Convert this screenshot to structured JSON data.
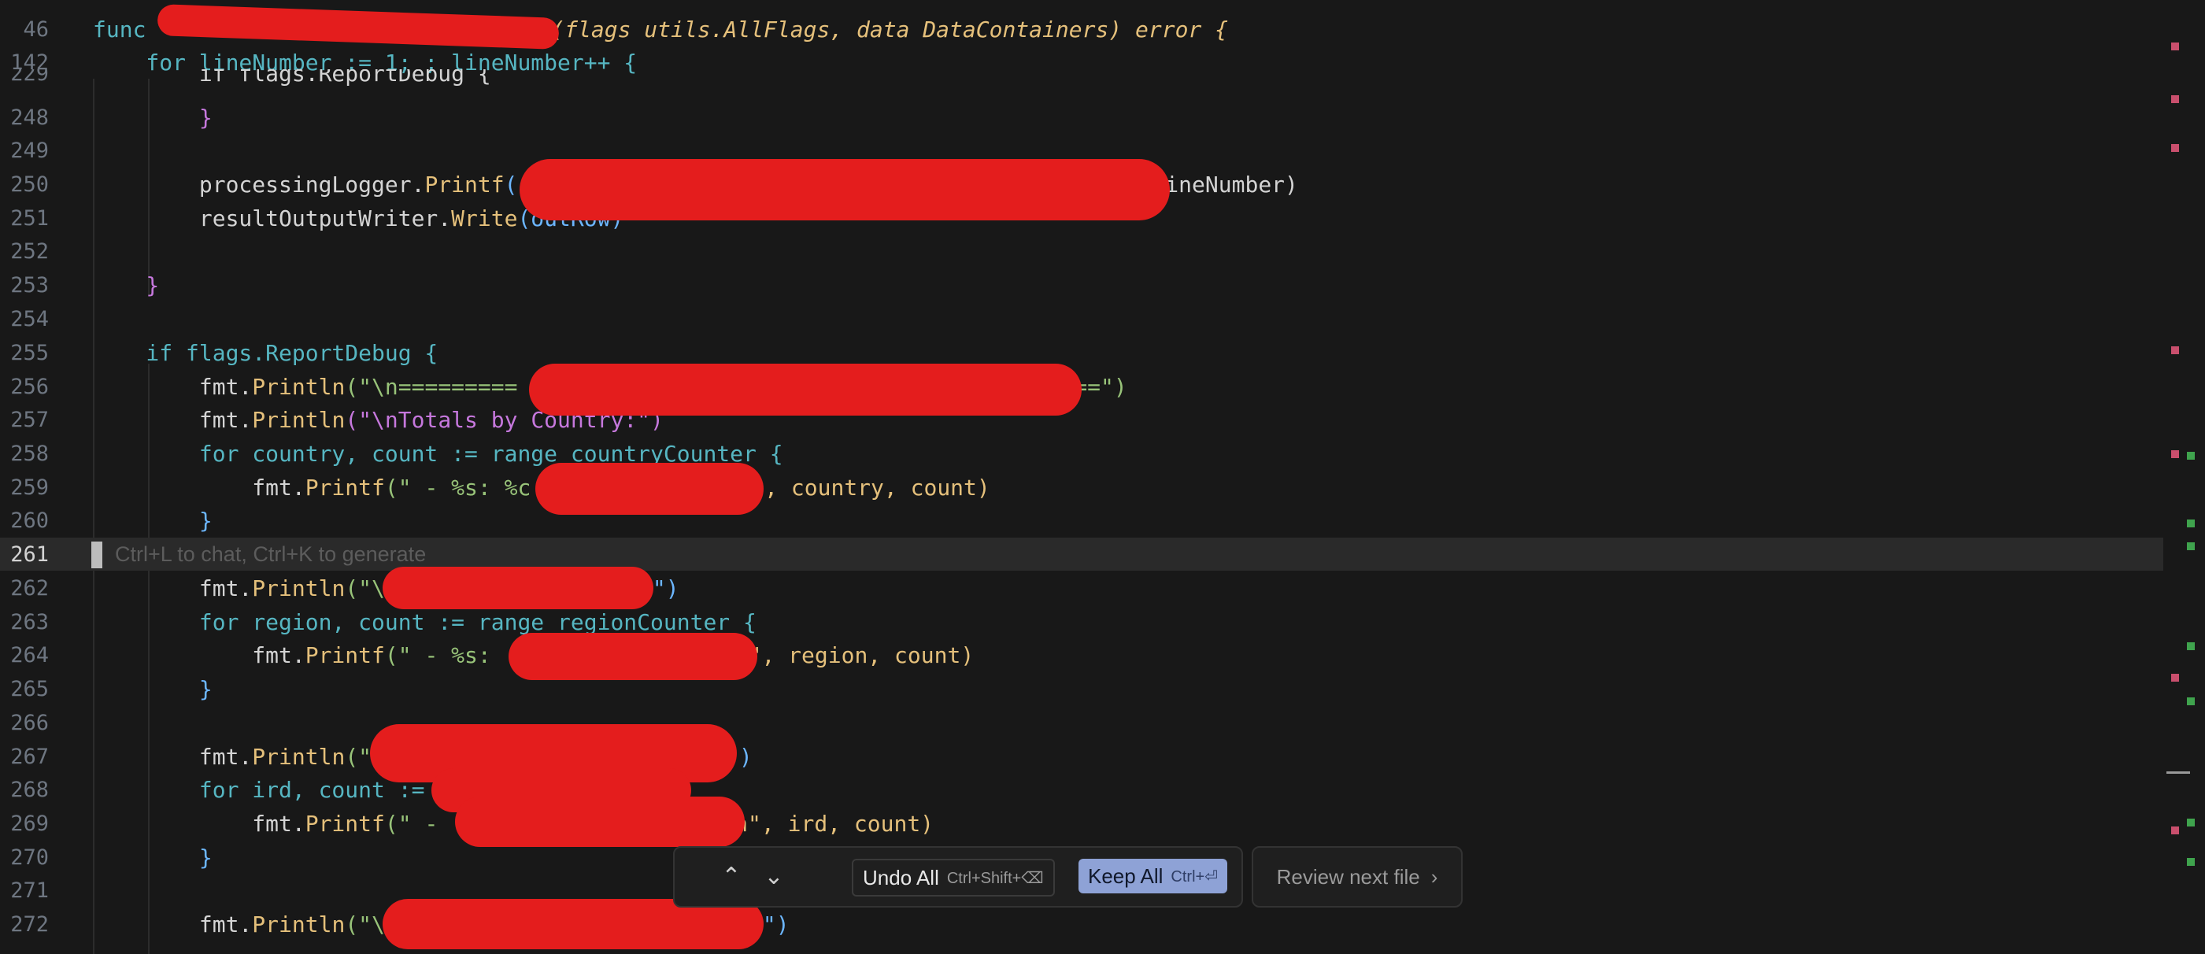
{
  "sticky": [
    {
      "ln": "46",
      "prefix": "func ",
      "args": "(flags utils.AllFlags, data DataContainers) error {"
    },
    {
      "ln": "142",
      "code": "    for lineNumber := 1; ; lineNumber++ {"
    },
    {
      "ln": "229",
      "code": "        if flags.ReportDebug {"
    }
  ],
  "lines": [
    {
      "ln": "248",
      "code": "        }"
    },
    {
      "ln": "249",
      "code": ""
    },
    {
      "ln": "250",
      "pre": "        processingLogger.",
      "fn": "Printf",
      "mid": "(",
      "post": "lineNumber)"
    },
    {
      "ln": "251",
      "pre": "        resultOutputWriter.",
      "fn": "Write",
      "mid": "(outRow)"
    },
    {
      "ln": "252",
      "code": ""
    },
    {
      "ln": "253",
      "code": "    }"
    },
    {
      "ln": "254",
      "code": ""
    },
    {
      "ln": "255",
      "pre": "    if flags.ReportDebug {"
    },
    {
      "ln": "256",
      "pre": "        fmt.",
      "fn": "Println",
      "mid": "(\"\\n=========",
      "post": "===\")"
    },
    {
      "ln": "257",
      "pre": "        fmt.",
      "fn": "Println",
      "mid": "(\"\\nTotals by Country:\")"
    },
    {
      "ln": "258",
      "pre": "        for country, count := range countryCounter {"
    },
    {
      "ln": "259",
      "pre": "            fmt.",
      "fn": "Printf",
      "mid": "(\" - %s: %c",
      "post": "\", country, count)"
    },
    {
      "ln": "260",
      "code": "        }"
    },
    {
      "ln": "261",
      "code": ""
    },
    {
      "ln": "262",
      "pre": "        fmt.",
      "fn": "Println",
      "mid": "(\"\\",
      "post": "\")"
    },
    {
      "ln": "263",
      "pre": "        for region, count := range regionCounter {"
    },
    {
      "ln": "264",
      "pre": "            fmt.",
      "fn": "Printf",
      "mid": "(\" - %s: ",
      "post": "\", region, count)"
    },
    {
      "ln": "265",
      "code": "        }"
    },
    {
      "ln": "266",
      "code": ""
    },
    {
      "ln": "267",
      "pre": "        fmt.",
      "fn": "Println",
      "mid": "(\"",
      "post": "\")"
    },
    {
      "ln": "268",
      "pre": "        for ird, count :=",
      "post": ""
    },
    {
      "ln": "269",
      "pre": "            fmt.",
      "fn": "Printf",
      "mid": "(\" - ",
      "post": "n\", ird, count)"
    },
    {
      "ln": "270",
      "code": "        }"
    },
    {
      "ln": "271",
      "code": ""
    },
    {
      "ln": "272",
      "pre": "        fmt.",
      "fn": "Println",
      "mid": "(\"\\",
      "post": "\")"
    }
  ],
  "inline_hint": "Ctrl+L to chat, Ctrl+K to generate",
  "diff_bar": {
    "undo_label": "Undo All",
    "undo_shortcut": "Ctrl+Shift+⌫",
    "keep_label": "Keep All",
    "keep_shortcut": "Ctrl+⏎",
    "review_label": "Review next file",
    "up_glyph": "⌃",
    "down_glyph": "⌄"
  },
  "colors": {
    "background": "#181818",
    "keep_button": "#8ea2d6",
    "redaction": "#e41d1d"
  }
}
